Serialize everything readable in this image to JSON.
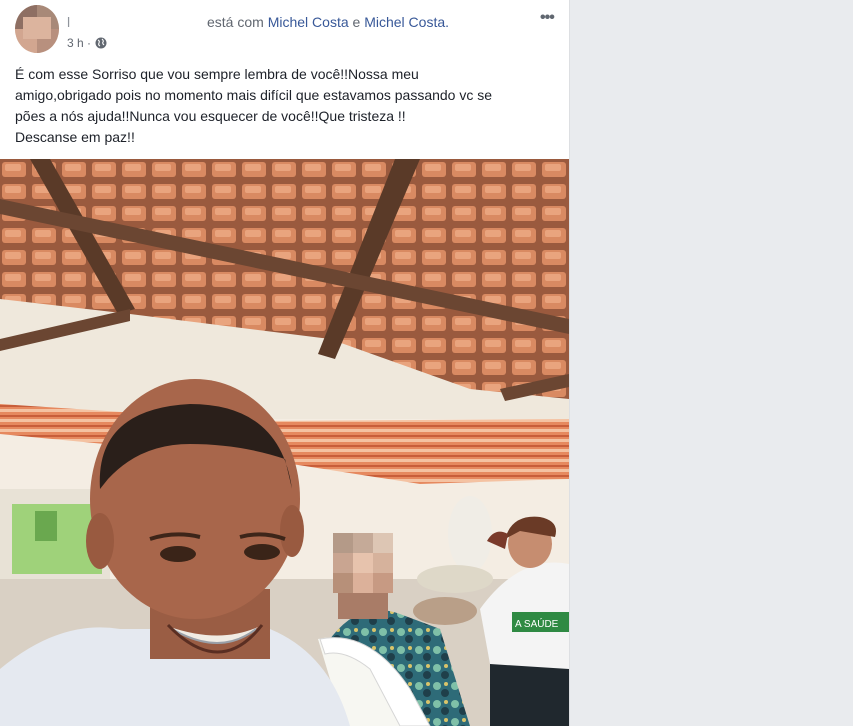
{
  "post": {
    "author": "l",
    "with_prefix": "está com",
    "tagged_1": "Michel Costa",
    "conjunction": "e",
    "tagged_2": "Michel Costa.",
    "timestamp": "3 h ·",
    "privacy_icon": "globe-icon",
    "more_icon": "more-options-icon",
    "more_label": "•••",
    "text_lines": [
      "É com esse Sorriso que vou sempre lembra de você!!Nossa meu",
      "amigo,obrigado pois no momento mais difícil que estavamos passando vc se",
      "pões a nós ajuda!!Nunca vou esquecer de você!!Que tristeza !!",
      "Descanse em paz!!"
    ],
    "photo_shirt_text": "A SAÚDE"
  },
  "colors": {
    "link": "#385898",
    "text": "#1d2129",
    "muted": "#616770",
    "background": "#e9ebee"
  }
}
